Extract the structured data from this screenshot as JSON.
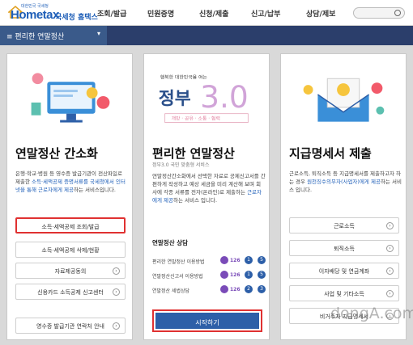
{
  "header": {
    "logo_text": "Hometax",
    "logo_tagline": "국세청 홈택스",
    "logo_subtext": "대한민국 국세청",
    "nav": [
      "조회/발급",
      "민원증명",
      "신청/제출",
      "신고/납부",
      "상담/제보"
    ]
  },
  "subbar": {
    "menu_label": "편리한 연말정산"
  },
  "card1": {
    "title": "연말정산 간소화",
    "desc_pre": "은행·학교·병원 등 영수증 발급기관이 전산파일로 제출한 ",
    "desc_hl": "소득·세액공제 증명서류를 국세청에서 인터넷을 통해 근로자에게 제공",
    "desc_post": "하는 서비스입니다.",
    "buttons": [
      "소득·세액공제 조회/발급",
      "소득·세액공제 삭제/현황",
      "자료제공동의",
      "신용카드 소득공제 신고센터",
      "영수증 발급기관 연락처 안내"
    ]
  },
  "card2": {
    "gov_caption": "행복한 대한민국을 여는",
    "gov_big": "정부",
    "gov_ver": "3.0",
    "gov_values": "개방 · 공유 · 소통 · 협력",
    "title": "편리한 연말정산",
    "subtitle": "정부3.0 국민 맞춤형 서비스",
    "desc_pre": "연말정산간소화에서 선택한 자료로 공제신고서를 간편하게 작성하고 예상 세금을 미리 계산해 보며 회사에 각종 서류를 전자(온라인)로 제출하는 ",
    "desc_hl": "근로자에게 제공",
    "desc_post": "하는 서비스 입니다.",
    "counsel_title": "연말정산 상담",
    "counsel_rows": [
      {
        "label": "편리한 연말정산 이용방법",
        "num": "126",
        "a": "1",
        "b": "5"
      },
      {
        "label": "연말정산신고서 이용방법",
        "num": "126",
        "a": "1",
        "b": "5"
      },
      {
        "label": "연말정산 세법상담",
        "num": "126",
        "a": "2",
        "b": "3"
      }
    ],
    "start_label": "시작하기"
  },
  "card3": {
    "title": "지급명세서 제출",
    "desc_pre": "근로소득, 퇴직소득 등 지급명세서를 제출하고자 하는 경우 ",
    "desc_hl": "원천징수의무자(사업자)에게 제공",
    "desc_post": "하는 서비스 입니다.",
    "buttons": [
      "근로소득",
      "퇴직소득",
      "이자배당 및 연금계좌",
      "사업 및 기타소득",
      "비거주자 지급명세서"
    ]
  },
  "watermark": "dongA.com",
  "colors": {
    "brand_blue": "#1f5fb8",
    "subbar_navy": "#2b3e6b",
    "highlight_red": "#e03131",
    "counsel_purple": "#7a4bb8"
  }
}
